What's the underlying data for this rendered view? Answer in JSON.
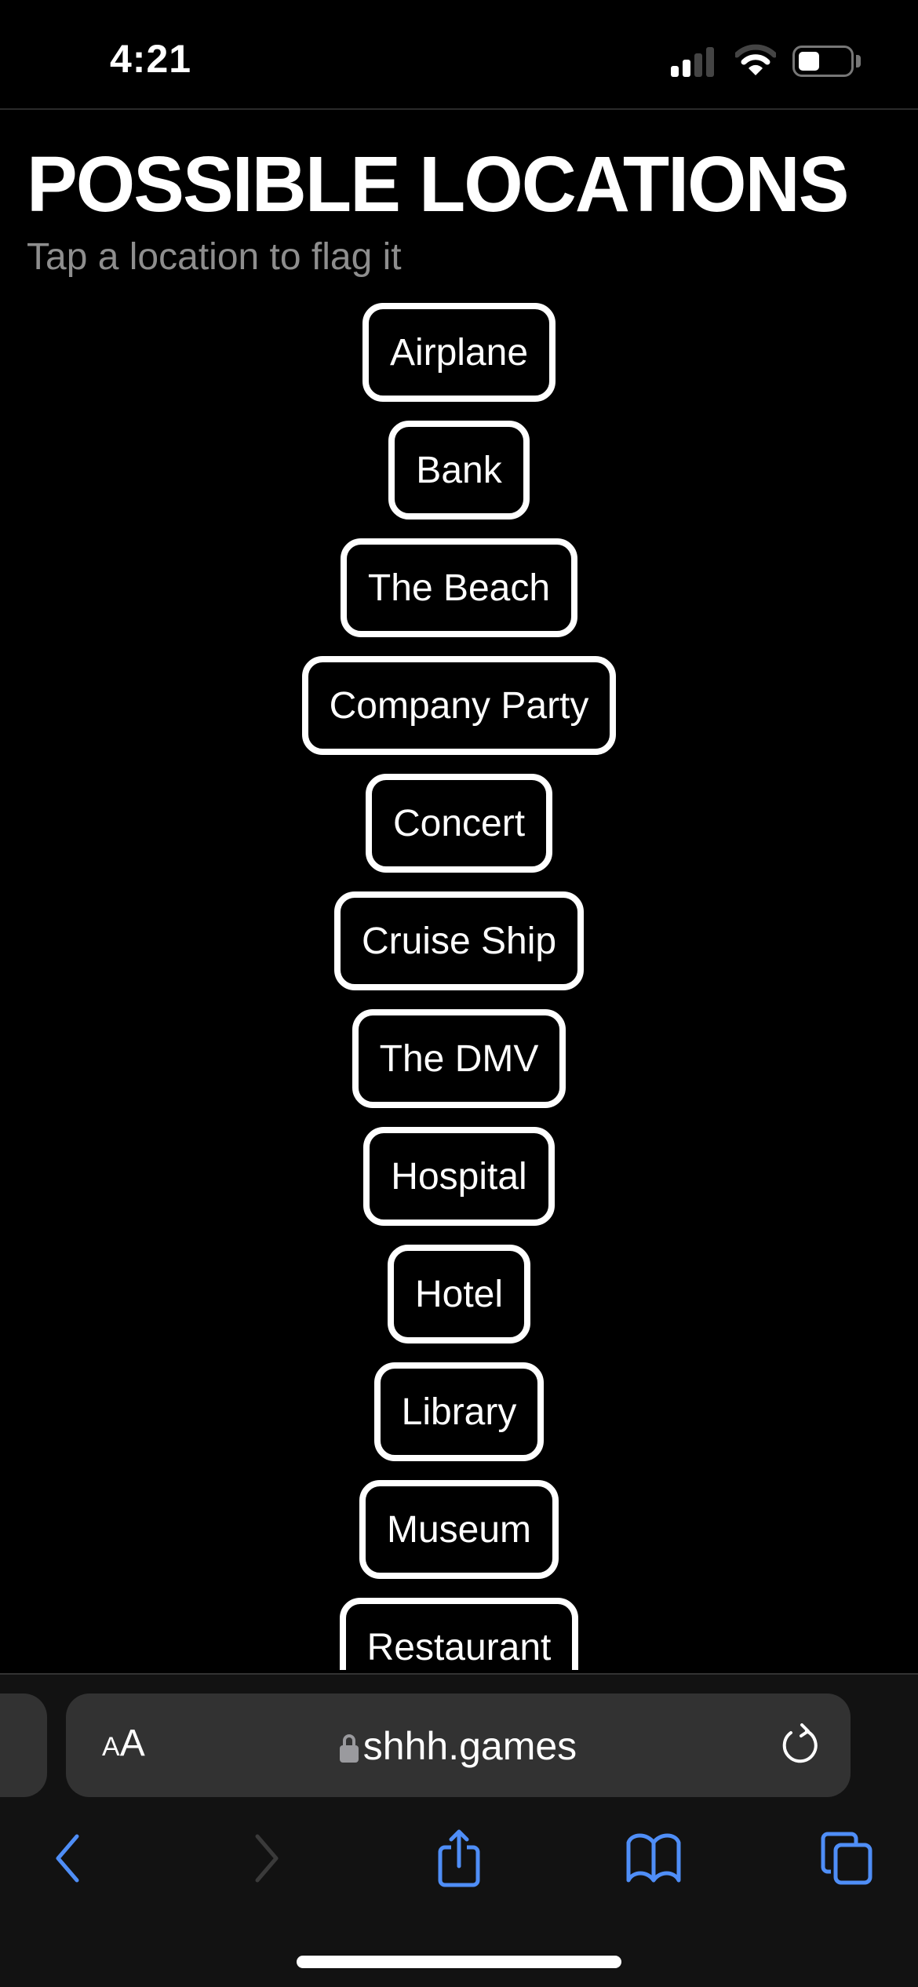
{
  "status_bar": {
    "time": "4:21",
    "signal_bars_active": 2,
    "signal_bars_total": 4,
    "battery_level": 0.4
  },
  "header": {
    "title": "POSSIBLE LOCATIONS",
    "subtitle": "Tap a location to flag it"
  },
  "locations": [
    "Airplane",
    "Bank",
    "The Beach",
    "Company Party",
    "Concert",
    "Cruise Ship",
    "The DMV",
    "Hospital",
    "Hotel",
    "Library",
    "Museum",
    "Restaurant"
  ],
  "browser": {
    "text_size_label_small": "A",
    "text_size_label_large": "A",
    "url": "shhh.games",
    "accent_color": "#4f8ef7",
    "disabled_color": "#3a3a3a"
  },
  "toolbar": {
    "items": [
      {
        "icon": "back-icon",
        "enabled": true
      },
      {
        "icon": "forward-icon",
        "enabled": false
      },
      {
        "icon": "share-icon",
        "enabled": true
      },
      {
        "icon": "bookmarks-icon",
        "enabled": true
      },
      {
        "icon": "tabs-icon",
        "enabled": true
      }
    ]
  }
}
